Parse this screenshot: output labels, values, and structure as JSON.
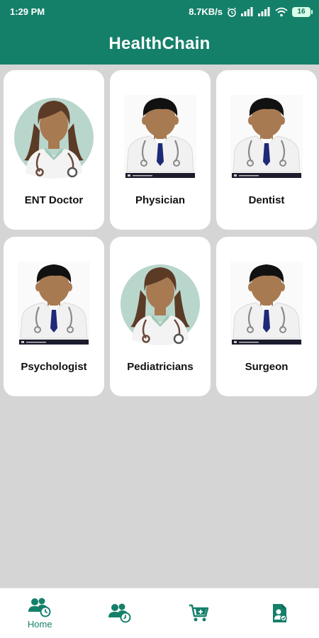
{
  "status_bar": {
    "time": "1:29 PM",
    "network_speed": "8.7KB/s",
    "battery": "16",
    "icons": [
      "alarm-icon",
      "signal-icon",
      "signal-icon",
      "wifi-icon",
      "battery-icon"
    ]
  },
  "app_bar": {
    "title": "HealthChain"
  },
  "specialists": [
    {
      "label": "ENT Doctor",
      "avatar": "female-doctor-avatar"
    },
    {
      "label": "Physician",
      "avatar": "male-doctor-avatar"
    },
    {
      "label": "Dentist",
      "avatar": "male-doctor-avatar"
    },
    {
      "label": "Psychologist",
      "avatar": "male-doctor-avatar"
    },
    {
      "label": "Pediatricians",
      "avatar": "female-doctor-avatar"
    },
    {
      "label": "Surgeon",
      "avatar": "male-doctor-avatar"
    }
  ],
  "bottom_nav": {
    "items": [
      {
        "label": "Home",
        "icon": "users-clock-icon",
        "active": true
      },
      {
        "label": "",
        "icon": "users-history-icon",
        "active": false
      },
      {
        "label": "",
        "icon": "cart-add-icon",
        "active": false
      },
      {
        "label": "",
        "icon": "user-document-icon",
        "active": false
      }
    ]
  },
  "colors": {
    "primary": "#15806a",
    "background": "#d5d5d5",
    "card": "#ffffff",
    "skin": "#a87a52",
    "hair": "#111111",
    "female_hair": "#5b3a26",
    "tie": "#1e2a78",
    "avatar_circle": "#b9d6cc"
  }
}
